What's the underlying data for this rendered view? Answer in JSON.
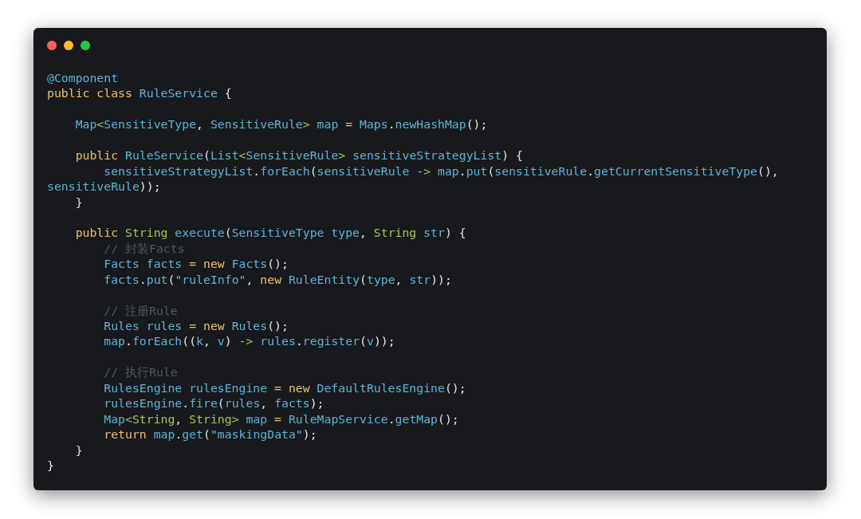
{
  "code": {
    "lines": [
      {
        "kind": "code",
        "tokens": [
          {
            "kind": "id",
            "text": "@Component"
          }
        ]
      },
      {
        "kind": "code",
        "tokens": [
          {
            "kind": "kw",
            "text": "public class "
          },
          {
            "kind": "id",
            "text": "RuleService "
          },
          {
            "kind": "p",
            "text": "{"
          }
        ]
      },
      {
        "kind": "blank"
      },
      {
        "kind": "code",
        "tokens": [
          {
            "kind": "id",
            "text": "    Map"
          },
          {
            "kind": "ty",
            "text": "<"
          },
          {
            "kind": "id",
            "text": "SensitiveType"
          },
          {
            "kind": "p",
            "text": ", "
          },
          {
            "kind": "id",
            "text": "SensitiveRule"
          },
          {
            "kind": "ty",
            "text": "> "
          },
          {
            "kind": "id",
            "text": "map "
          },
          {
            "kind": "kw",
            "text": "= "
          },
          {
            "kind": "id",
            "text": "Maps"
          },
          {
            "kind": "p",
            "text": "."
          },
          {
            "kind": "id",
            "text": "newHashMap"
          },
          {
            "kind": "p",
            "text": "();"
          }
        ]
      },
      {
        "kind": "blank"
      },
      {
        "kind": "code",
        "tokens": [
          {
            "kind": "kw",
            "text": "    public "
          },
          {
            "kind": "id",
            "text": "RuleService"
          },
          {
            "kind": "p",
            "text": "("
          },
          {
            "kind": "id",
            "text": "List"
          },
          {
            "kind": "ty",
            "text": "<"
          },
          {
            "kind": "id",
            "text": "SensitiveRule"
          },
          {
            "kind": "ty",
            "text": "> "
          },
          {
            "kind": "id",
            "text": "sensitiveStrategyList"
          },
          {
            "kind": "p",
            "text": ") {"
          }
        ]
      },
      {
        "kind": "code",
        "tokens": [
          {
            "kind": "id",
            "text": "        sensitiveStrategyList"
          },
          {
            "kind": "p",
            "text": "."
          },
          {
            "kind": "id",
            "text": "forEach"
          },
          {
            "kind": "p",
            "text": "("
          },
          {
            "kind": "id",
            "text": "sensitiveRule "
          },
          {
            "kind": "ty",
            "text": "-> "
          },
          {
            "kind": "id",
            "text": "map"
          },
          {
            "kind": "p",
            "text": "."
          },
          {
            "kind": "id",
            "text": "put"
          },
          {
            "kind": "p",
            "text": "("
          },
          {
            "kind": "id",
            "text": "sensitiveRule"
          },
          {
            "kind": "p",
            "text": "."
          },
          {
            "kind": "id",
            "text": "getCurrentSensitiveType"
          },
          {
            "kind": "p",
            "text": "(),"
          }
        ]
      },
      {
        "kind": "code",
        "tokens": [
          {
            "kind": "id",
            "text": "sensitiveRule"
          },
          {
            "kind": "p",
            "text": "));"
          }
        ]
      },
      {
        "kind": "code",
        "tokens": [
          {
            "kind": "p",
            "text": "    }"
          }
        ]
      },
      {
        "kind": "blank"
      },
      {
        "kind": "code",
        "tokens": [
          {
            "kind": "kw",
            "text": "    public "
          },
          {
            "kind": "ty",
            "text": "String "
          },
          {
            "kind": "id",
            "text": "execute"
          },
          {
            "kind": "p",
            "text": "("
          },
          {
            "kind": "id",
            "text": "SensitiveType type"
          },
          {
            "kind": "p",
            "text": ", "
          },
          {
            "kind": "ty",
            "text": "String "
          },
          {
            "kind": "id",
            "text": "str"
          },
          {
            "kind": "p",
            "text": ") {"
          }
        ]
      },
      {
        "kind": "code",
        "tokens": [
          {
            "kind": "cm",
            "text": "        // 封装Facts"
          }
        ]
      },
      {
        "kind": "code",
        "tokens": [
          {
            "kind": "id",
            "text": "        Facts facts "
          },
          {
            "kind": "kw",
            "text": "= new "
          },
          {
            "kind": "id",
            "text": "Facts"
          },
          {
            "kind": "p",
            "text": "();"
          }
        ]
      },
      {
        "kind": "code",
        "tokens": [
          {
            "kind": "id",
            "text": "        facts"
          },
          {
            "kind": "p",
            "text": "."
          },
          {
            "kind": "id",
            "text": "put"
          },
          {
            "kind": "p",
            "text": "("
          },
          {
            "kind": "id",
            "text": "\"ruleInfo\""
          },
          {
            "kind": "p",
            "text": ", "
          },
          {
            "kind": "kw",
            "text": "new "
          },
          {
            "kind": "id",
            "text": "RuleEntity"
          },
          {
            "kind": "p",
            "text": "("
          },
          {
            "kind": "id",
            "text": "type"
          },
          {
            "kind": "p",
            "text": ", "
          },
          {
            "kind": "id",
            "text": "str"
          },
          {
            "kind": "p",
            "text": "));"
          }
        ]
      },
      {
        "kind": "blank"
      },
      {
        "kind": "code",
        "tokens": [
          {
            "kind": "cm",
            "text": "        // 注册Rule"
          }
        ]
      },
      {
        "kind": "code",
        "tokens": [
          {
            "kind": "id",
            "text": "        Rules rules "
          },
          {
            "kind": "kw",
            "text": "= new "
          },
          {
            "kind": "id",
            "text": "Rules"
          },
          {
            "kind": "p",
            "text": "();"
          }
        ]
      },
      {
        "kind": "code",
        "tokens": [
          {
            "kind": "id",
            "text": "        map"
          },
          {
            "kind": "p",
            "text": "."
          },
          {
            "kind": "id",
            "text": "forEach"
          },
          {
            "kind": "p",
            "text": "(("
          },
          {
            "kind": "id",
            "text": "k"
          },
          {
            "kind": "p",
            "text": ", "
          },
          {
            "kind": "id",
            "text": "v"
          },
          {
            "kind": "p",
            "text": ") "
          },
          {
            "kind": "ty",
            "text": "-> "
          },
          {
            "kind": "id",
            "text": "rules"
          },
          {
            "kind": "p",
            "text": "."
          },
          {
            "kind": "id",
            "text": "register"
          },
          {
            "kind": "p",
            "text": "("
          },
          {
            "kind": "id",
            "text": "v"
          },
          {
            "kind": "p",
            "text": "));"
          }
        ]
      },
      {
        "kind": "blank"
      },
      {
        "kind": "code",
        "tokens": [
          {
            "kind": "cm",
            "text": "        // 执行Rule"
          }
        ]
      },
      {
        "kind": "code",
        "tokens": [
          {
            "kind": "id",
            "text": "        RulesEngine rulesEngine "
          },
          {
            "kind": "kw",
            "text": "= new "
          },
          {
            "kind": "id",
            "text": "DefaultRulesEngine"
          },
          {
            "kind": "p",
            "text": "();"
          }
        ]
      },
      {
        "kind": "code",
        "tokens": [
          {
            "kind": "id",
            "text": "        rulesEngine"
          },
          {
            "kind": "p",
            "text": "."
          },
          {
            "kind": "id",
            "text": "fire"
          },
          {
            "kind": "p",
            "text": "("
          },
          {
            "kind": "id",
            "text": "rules"
          },
          {
            "kind": "p",
            "text": ", "
          },
          {
            "kind": "id",
            "text": "facts"
          },
          {
            "kind": "p",
            "text": ");"
          }
        ]
      },
      {
        "kind": "code",
        "tokens": [
          {
            "kind": "id",
            "text": "        Map"
          },
          {
            "kind": "ty",
            "text": "<String"
          },
          {
            "kind": "p",
            "text": ", "
          },
          {
            "kind": "ty",
            "text": "String> "
          },
          {
            "kind": "id",
            "text": "map "
          },
          {
            "kind": "kw",
            "text": "= "
          },
          {
            "kind": "id",
            "text": "RuleMapService"
          },
          {
            "kind": "p",
            "text": "."
          },
          {
            "kind": "id",
            "text": "getMap"
          },
          {
            "kind": "p",
            "text": "();"
          }
        ]
      },
      {
        "kind": "code",
        "tokens": [
          {
            "kind": "kw",
            "text": "        return "
          },
          {
            "kind": "id",
            "text": "map"
          },
          {
            "kind": "p",
            "text": "."
          },
          {
            "kind": "id",
            "text": "get"
          },
          {
            "kind": "p",
            "text": "("
          },
          {
            "kind": "id",
            "text": "\"maskingData\""
          },
          {
            "kind": "p",
            "text": ");"
          }
        ]
      },
      {
        "kind": "code",
        "tokens": [
          {
            "kind": "p",
            "text": "    }"
          }
        ]
      },
      {
        "kind": "code",
        "tokens": [
          {
            "kind": "p",
            "text": "}"
          }
        ]
      }
    ]
  }
}
